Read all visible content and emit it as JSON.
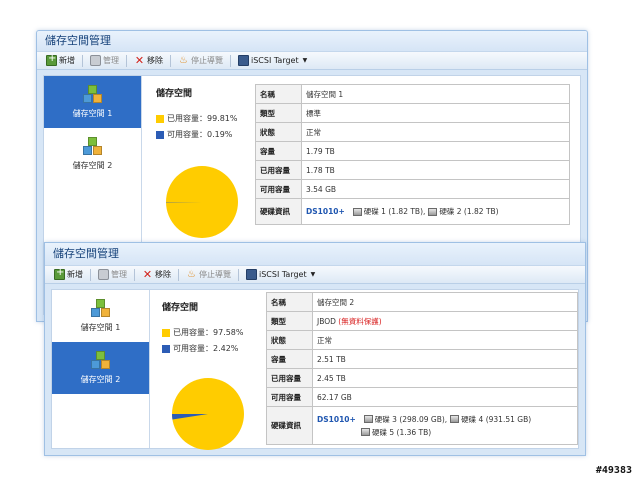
{
  "windows": [
    {
      "title": "儲存空間管理",
      "toolbar": {
        "new": "新增",
        "manage": "管理",
        "remove": "移除",
        "stop_sharing": "停止導覽",
        "iscsi": "iSCSI Target"
      },
      "sidebar": [
        "儲存空間 1",
        "儲存空間 2"
      ],
      "active_index": 0,
      "summary": {
        "title": "儲存空間",
        "used": "已用容量：99.81%",
        "free": "可用容量：0.19%",
        "used_fraction": 0.9981
      },
      "rows": [
        {
          "k": "名稱",
          "v": "儲存空間 1"
        },
        {
          "k": "類型",
          "v": "標準"
        },
        {
          "k": "狀態",
          "v": "正常"
        },
        {
          "k": "容量",
          "v": "1.79 TB"
        },
        {
          "k": "已用容量",
          "v": "1.78 TB"
        },
        {
          "k": "可用容量",
          "v": "3.54 GB"
        }
      ],
      "hw": {
        "k": "硬碟資訊",
        "model": "DS1010+",
        "disks": [
          "硬碟 1 (1.82 TB),",
          "硬碟 2 (1.82 TB)"
        ]
      }
    },
    {
      "title": "儲存空間管理",
      "toolbar": {
        "new": "新增",
        "manage": "管理",
        "remove": "移除",
        "stop_sharing": "停止導覽",
        "iscsi": "iSCSI Target"
      },
      "sidebar": [
        "儲存空間 1",
        "儲存空間 2"
      ],
      "active_index": 1,
      "summary": {
        "title": "儲存空間",
        "used": "已用容量：97.58%",
        "free": "可用容量：2.42%",
        "used_fraction": 0.9758
      },
      "rows": [
        {
          "k": "名稱",
          "v": "儲存空間 2"
        },
        {
          "k": "類型",
          "v": "JBOD",
          "note": "(無資料保護)"
        },
        {
          "k": "狀態",
          "v": "正常"
        },
        {
          "k": "容量",
          "v": "2.51 TB"
        },
        {
          "k": "已用容量",
          "v": "2.45 TB"
        },
        {
          "k": "可用容量",
          "v": "62.17 GB"
        }
      ],
      "hw": {
        "k": "硬碟資訊",
        "model": "DS1010+",
        "disks": [
          "硬碟 3 (298.09 GB),",
          "硬碟 4 (931.51 GB)",
          "硬碟 5 (1.36 TB)"
        ]
      }
    }
  ],
  "colors": {
    "used": "#ffcc00",
    "free": "#2c5cb5",
    "active": "#2f6ec6"
  },
  "watermark": "#49383"
}
